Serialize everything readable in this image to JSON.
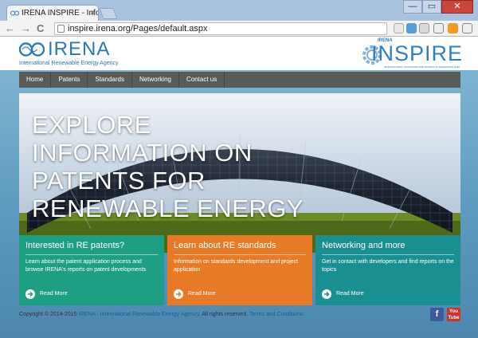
{
  "browser": {
    "tab_title": "IRENA INSPIRE - Inform",
    "tab_close": "×",
    "url": "inspire.irena.org/Pages/default.aspx",
    "back": "←",
    "forward": "→",
    "reload": "C",
    "window_min": "—",
    "window_max": "▭",
    "window_close": "✕"
  },
  "header": {
    "logo_text": "IRENA",
    "logo_subtitle": "International Renewable Energy Agency",
    "inspire_brand": "IRENA",
    "inspire_word": "INSPIRE",
    "inspire_tagline": "INTERNATIONAL STANDARDS AND PATENTS IN RENEWABLE ENERGY"
  },
  "nav": {
    "items": [
      "Home",
      "Patents",
      "Standards",
      "Networking",
      "Contact us"
    ]
  },
  "hero": {
    "title": "EXPLORE INFORMATION ON PATENTS FOR RENEWABLE ENERGY"
  },
  "cards": [
    {
      "title": "Interested in RE patents?",
      "text": "Learn about the patent application process and browse IRENA's reports on patent developments",
      "link": "Read More"
    },
    {
      "title": "Learn about RE standards",
      "text": "Information on standards development and project application",
      "link": "Read More"
    },
    {
      "title": "Networking and more",
      "text": "Get in contact with developers and find reports on the topics",
      "link": "Read More"
    }
  ],
  "footer": {
    "copyright_prefix": "Copyright © 2014-2015 ",
    "org_link": "IRENA - International Renewable Energy Agency",
    "rights": ". All rights reserved. ",
    "terms_link": "Terms and Conditions"
  },
  "social": {
    "facebook": "f",
    "youtube": "You Tube"
  },
  "colors": {
    "card_teal": "#1e9e83",
    "card_orange": "#e77a27",
    "card_teal2": "#1a8f92",
    "nav_bg": "#5a5a5a",
    "brand_blue": "#2c78b5"
  }
}
